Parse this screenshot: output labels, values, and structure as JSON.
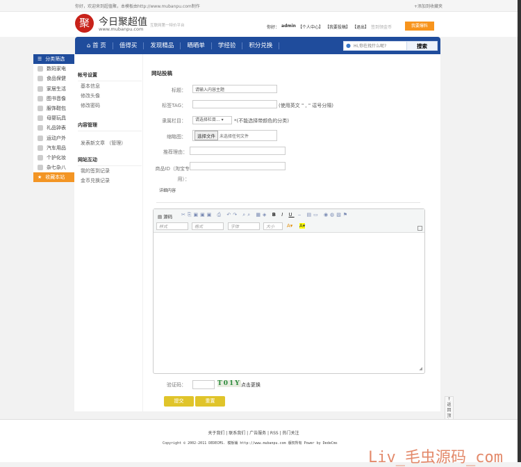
{
  "topbar": {
    "welcome": "你好，欢迎来到超值聚，本模板由http://www.mubanpu.com制作",
    "bookmark": "+添加到收藏夹"
  },
  "header": {
    "logo_glyph": "聚",
    "logo_title": "今日聚超值",
    "logo_url": "www.mubanpu.com",
    "slogan": "互联网第一特价平台",
    "hello": "你好：",
    "user": "admin",
    "links": [
      "【个人中心】",
      "【我要投稿】",
      "【退出】"
    ],
    "signin": "签到领金币",
    "report": "我要爆料"
  },
  "nav": {
    "items": [
      "首 页",
      "值得买",
      "发现精品",
      "晒晒单",
      "学经验",
      "积分兑换"
    ],
    "search_placeholder": "Hi,你在找什么呢?",
    "search_button": "搜索"
  },
  "categories": {
    "head": "分类筛选",
    "items": [
      "数码家电",
      "食品保健",
      "家居生活",
      "图书音像",
      "服饰鞋包",
      "母婴玩具",
      "礼品钟表",
      "运动户外",
      "汽车用品",
      "个护化妆",
      "杂七杂八"
    ],
    "fav": "收藏本站"
  },
  "side": {
    "sections": [
      {
        "title": "帐号设置",
        "items": [
          "基本信息",
          "修改头像",
          "修改密码"
        ]
      },
      {
        "title": "内容管理",
        "items": [
          "发表新文章 （管理）"
        ]
      },
      {
        "title": "网站互动",
        "items": [
          "我的签到记录",
          "金币兑换记录"
        ]
      }
    ]
  },
  "form": {
    "title": "网站投稿",
    "title_label": "标题：",
    "title_value": "请输入内容主题",
    "tag_label": "标签TAG：",
    "tag_hint": "(使用英文 \" , \" 逗号分隔)",
    "column_label": "隶属栏目：",
    "column_select": "请选择栏目...",
    "column_hint": "*(不能选择带颜色的分类)",
    "thumb_label": "缩略图：",
    "file_button": "选择文件",
    "file_status": "未选择任何文件",
    "reason_label": "推荐理由：",
    "goods_label": "商品ID（淘宝专用）：",
    "detail_label": "详细内容",
    "editor": {
      "source": "源码",
      "style": "样式",
      "format": "格式",
      "font": "字体",
      "size": "大小"
    },
    "captcha_label": "验证码：",
    "captcha": "T01Y",
    "captcha_refresh": "点击更换",
    "submit": "提交",
    "reset": "重置"
  },
  "back_top": "返回顶部",
  "footer": {
    "links": "关于我们 | 联系我们 | 广告服务 | RSS | 热门关注",
    "copyright": "Copyright © 2002-2011 DEDECMS. 模板铺 http://www.mubanpu.com 版权所有 Power by DedeCms"
  },
  "watermark": "Liv_毛虫源码_com"
}
